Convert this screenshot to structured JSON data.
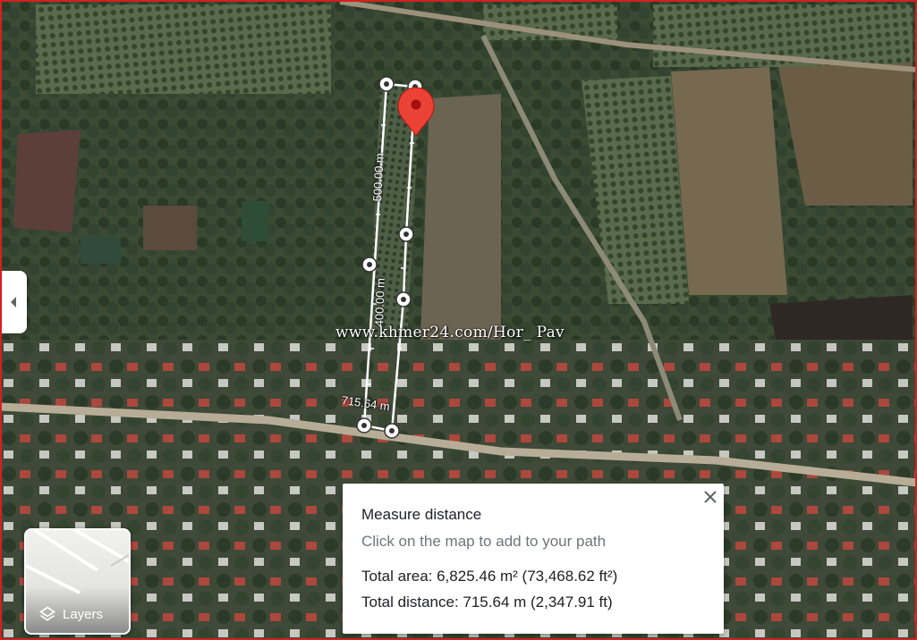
{
  "map": {
    "watermark": "www.khmer24.com/Hor_ Pav",
    "measure_labels": {
      "segment_top": "500.00 m",
      "segment_mid": "400.00 m",
      "total": "715.64 m"
    }
  },
  "measure_panel": {
    "title": "Measure distance",
    "hint": "Click on the map to add to your path",
    "total_area": "Total area: 6,825.46 m² (73,468.62 ft²)",
    "total_distance": "Total distance: 715.64 m (2,347.91 ft)"
  },
  "layers_button": {
    "label": "Layers"
  },
  "icons": {
    "collapse": "chevron-left-icon",
    "close": "close-icon",
    "layers": "layers-icon",
    "marker": "map-pin-icon"
  },
  "colors": {
    "marker": "#ea4335",
    "frame": "#d42020",
    "measure_line": "#ffffff"
  }
}
